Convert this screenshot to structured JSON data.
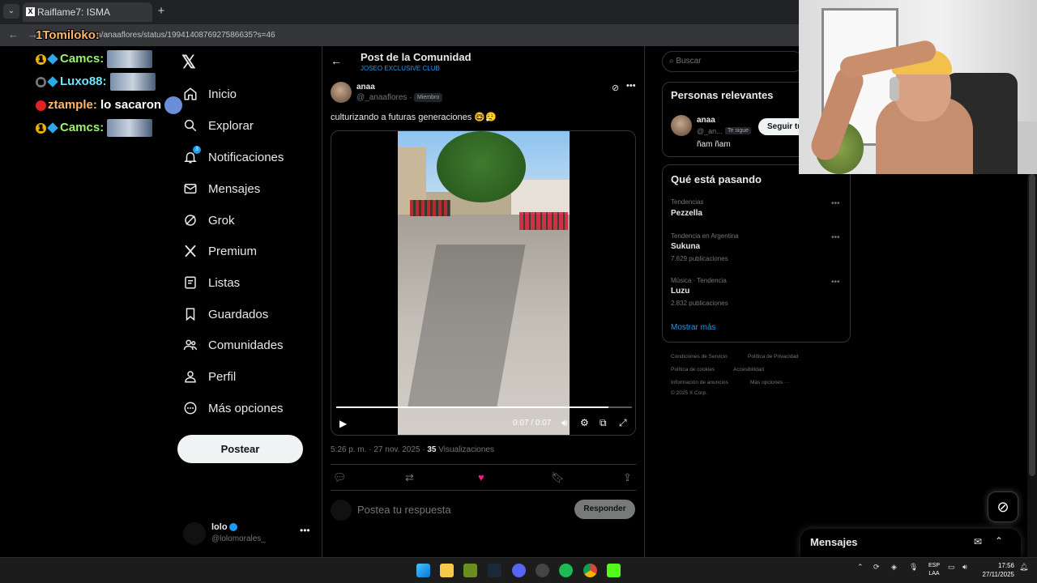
{
  "browser": {
    "tab_title": "Raiflame7: ISMA",
    "url": "x.com/anaaflores/status/1994140876927586635?s=46"
  },
  "stream_chat": [
    {
      "user": "1Tomiloko:",
      "message": ""
    },
    {
      "user": "Camcs:",
      "message": ""
    },
    {
      "user": "Luxo88:",
      "message": ""
    },
    {
      "user": "ztample:",
      "message": "lo sacaron"
    },
    {
      "user": "Camcs:",
      "message": ""
    }
  ],
  "sidebar": {
    "logo": "𝕏",
    "items": [
      {
        "label": "Inicio",
        "icon": "home-icon"
      },
      {
        "label": "Explorar",
        "icon": "search-icon"
      },
      {
        "label": "Notificaciones",
        "icon": "bell-icon",
        "badge": "3"
      },
      {
        "label": "Mensajes",
        "icon": "mail-icon"
      },
      {
        "label": "Grok",
        "icon": "grok-icon"
      },
      {
        "label": "Premium",
        "icon": "x-icon"
      },
      {
        "label": "Listas",
        "icon": "list-icon"
      },
      {
        "label": "Guardados",
        "icon": "bookmark-icon"
      },
      {
        "label": "Comunidades",
        "icon": "people-icon"
      },
      {
        "label": "Perfil",
        "icon": "person-icon"
      },
      {
        "label": "Más opciones",
        "icon": "more-circle-icon"
      }
    ],
    "post_button": "Postear",
    "account": {
      "name": "lolo",
      "handle": "@lolomorales_"
    }
  },
  "main": {
    "title": "Post de la Comunidad",
    "subtitle": "JOSEO EXCLUSIVE CLUB",
    "post": {
      "author_name": "anaa",
      "author_handle": "@_anaaflores ·",
      "member_badge": "Miembro",
      "text": "culturizando a futuras generaciones 🤓😮‍💨",
      "video": {
        "time": "0:07 / 0:07",
        "progress": 0.92
      },
      "meta_time": "5:26 p. m. · 27 nov. 2025 · ",
      "views_count": "35",
      "views_label": " Visualizaciones"
    },
    "reply_placeholder": "Postea tu respuesta",
    "reply_button": "Responder"
  },
  "right": {
    "search_placeholder": "Buscar",
    "relevant_title": "Personas relevantes",
    "relevant_person": {
      "name": "anaa",
      "handle": "@_an...",
      "follows_badge": "Te sigue",
      "bio": "ñam ñam",
      "follow_button": "Seguir tú"
    },
    "trends_title": "Qué está pasando",
    "trends": [
      {
        "context": "Tendencias",
        "name": "Pezzella",
        "count": ""
      },
      {
        "context": "Tendencia en Argentina",
        "name": "Sukuna",
        "count": "7.629 publicaciones"
      },
      {
        "context": "Música · Tendencia",
        "name": "Luzu",
        "count": "2.832 publicaciones"
      }
    ],
    "show_more": "Mostrar más",
    "footer": {
      "line1": [
        "Condiciones de Servicio",
        "Política de Privacidad"
      ],
      "line2": [
        "Política de cookies",
        "Accesibilidad"
      ],
      "line3": [
        "Información de anuncios",
        "Más opciones ···"
      ],
      "copyright": "© 2025 X Corp."
    }
  },
  "messages_bar": {
    "title": "Mensajes"
  },
  "taskbar": {
    "lang_top": "ESP",
    "lang_bottom": "LAA",
    "time": "17:56",
    "date": "27/11/2025"
  },
  "colors": {
    "accent": "#1d9bf0",
    "background": "#000000",
    "border": "#2f3336"
  }
}
